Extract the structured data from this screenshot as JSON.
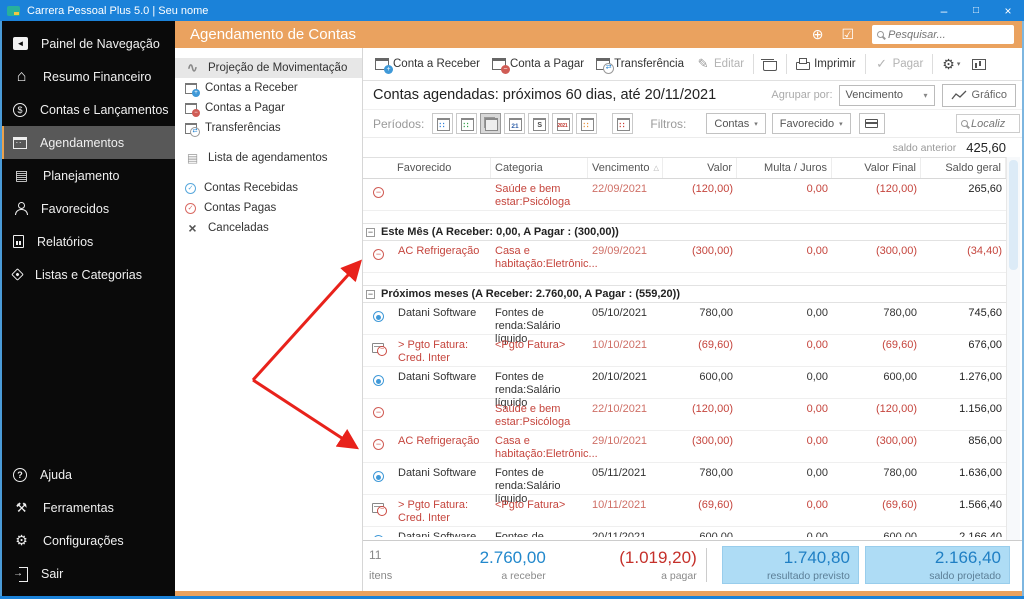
{
  "window": {
    "title": "Carrera Pessoal Plus 5.0 | Seu nome",
    "controls": [
      {
        "name": "minimize",
        "glyph": "–"
      },
      {
        "name": "maximize",
        "glyph": "□"
      },
      {
        "name": "close",
        "glyph": "×"
      }
    ]
  },
  "header": {
    "title": "Agendamento de Contas",
    "add_icon": "⊕",
    "check_icon": "☑",
    "search_placeholder": "Pesquisar..."
  },
  "nav_sidebar": {
    "items": [
      {
        "name": "panel",
        "label": "Painel de Navegação",
        "icon": "panel",
        "glyph": "◄"
      },
      {
        "name": "resumo",
        "label": "Resumo Financeiro",
        "icon": "home",
        "glyph": "⌂"
      },
      {
        "name": "contas",
        "label": "Contas e Lançamentos",
        "icon": "coins",
        "glyph": "$"
      },
      {
        "name": "agendamentos",
        "label": "Agendamentos",
        "icon": "calendar",
        "selected": true
      },
      {
        "name": "planejamento",
        "label": "Planejamento",
        "icon": "rows",
        "glyph": "▤"
      },
      {
        "name": "favorecidos",
        "label": "Favorecidos",
        "icon": "people"
      },
      {
        "name": "relatorios",
        "label": "Relatórios",
        "icon": "doc"
      },
      {
        "name": "listas",
        "label": "Listas e Categorias",
        "icon": "tag"
      }
    ],
    "footer_items": [
      {
        "name": "ajuda",
        "label": "Ajuda",
        "icon": "help",
        "glyph": "?"
      },
      {
        "name": "ferramentas",
        "label": "Ferramentas",
        "icon": "tools",
        "glyph": "⚒"
      },
      {
        "name": "configuracoes",
        "label": "Configurações",
        "icon": "gear",
        "glyph": "⚙"
      },
      {
        "name": "sair",
        "label": "Sair",
        "icon": "exit",
        "glyph": "→"
      }
    ]
  },
  "sub_sidebar": {
    "items": [
      {
        "label": "Projeção de Movimentação",
        "icon": "chart",
        "glyph": "∿",
        "selected": true
      },
      {
        "label": "Contas a Receber",
        "icon": "cal-plus"
      },
      {
        "label": "Contas a Pagar",
        "icon": "cal-minus"
      },
      {
        "label": "Transferências",
        "icon": "cal-arrows"
      },
      {
        "label": "Lista de agendamentos",
        "icon": "list",
        "glyph": "▤",
        "gap": true
      },
      {
        "label": "Contas Recebidas",
        "icon": "check-blue",
        "glyph": "✓",
        "gap": true
      },
      {
        "label": "Contas Pagas",
        "icon": "check-red",
        "glyph": "✓"
      },
      {
        "label": "Canceladas",
        "icon": "x",
        "glyph": "×"
      }
    ]
  },
  "toolbar": {
    "items": [
      {
        "name": "conta-a-receber",
        "label": "Conta a Receber",
        "icon": "cal-plus"
      },
      {
        "name": "conta-a-pagar",
        "label": "Conta a Pagar",
        "icon": "cal-minus"
      },
      {
        "name": "transferencia",
        "label": "Transferência",
        "icon": "cal-arrows"
      },
      {
        "name": "editar",
        "label": "Editar",
        "icon": "pencil",
        "glyph": "✎",
        "disabled": true
      },
      {
        "divider": true
      },
      {
        "name": "excluir",
        "label": "",
        "icon": "trash"
      },
      {
        "divider": true
      },
      {
        "name": "imprimir",
        "label": "Imprimir",
        "icon": "printer"
      },
      {
        "divider": true
      },
      {
        "name": "pagar",
        "label": "Pagar",
        "icon": "check",
        "glyph": "✓",
        "disabled": true
      },
      {
        "divider": true
      },
      {
        "name": "opcoes",
        "label": "",
        "icon": "gear",
        "glyph": "⚙"
      },
      {
        "name": "colunas",
        "label": "",
        "icon": "columns"
      }
    ]
  },
  "content_header": {
    "title": "Contas agendadas: próximos 60 dias, até 20/11/2021",
    "group_by_label": "Agrupar por:",
    "group_by_value": "Vencimento",
    "chart_button_label": "Gráfico"
  },
  "filter_bar": {
    "periods_label": "Períodos:",
    "period_buttons": [
      {
        "name": "week-blue"
      },
      {
        "name": "week-green"
      },
      {
        "name": "stack",
        "selected": true
      },
      {
        "name": "day-21"
      },
      {
        "name": "week-s"
      },
      {
        "name": "year-2021"
      },
      {
        "name": "month-orange"
      },
      {
        "name": "custom-red",
        "gap": true
      }
    ],
    "filters_label": "Filtros:",
    "filter_buttons": [
      {
        "label": "Contas"
      },
      {
        "label": "Favorecido"
      }
    ],
    "search_placeholder": "Localiz"
  },
  "table": {
    "prev_balance_label": "saldo anterior",
    "prev_balance_value": "425,60",
    "columns": [
      "Favorecido",
      "Categoria",
      "Vencimento",
      "Valor",
      "Multa / Juros",
      "Valor Final",
      "Saldo geral"
    ],
    "rows": [
      {
        "type": "row",
        "icon": "minus",
        "neg": true,
        "favorecido": "",
        "categoria": "Saúde e bem estar:Psicóloga",
        "vencimento": "22/09/2021",
        "valor": "(120,00)",
        "multa": "0,00",
        "valor_final": "(120,00)",
        "saldo": "265,60"
      },
      {
        "type": "spacer"
      },
      {
        "type": "group",
        "label": "Este Mês (A Receber: 0,00,  A Pagar : (300,00))"
      },
      {
        "type": "row",
        "icon": "minus",
        "neg": true,
        "saldo_neg": true,
        "favorecido": "AC Refrigeração",
        "categoria": "Casa e habitação:Eletrônic...",
        "vencimento": "29/09/2021",
        "valor": "(300,00)",
        "multa": "0,00",
        "valor_final": "(300,00)",
        "saldo": "(34,40)"
      },
      {
        "type": "spacer"
      },
      {
        "type": "group",
        "label": "Próximos meses (A Receber: 2.760,00,  A Pagar : (559,20))"
      },
      {
        "type": "row",
        "icon": "plus",
        "favorecido": "Datani Software",
        "categoria": "Fontes de renda:Salário líquido",
        "vencimento": "05/10/2021",
        "valor": "780,00",
        "multa": "0,00",
        "valor_final": "780,00",
        "saldo": "745,60"
      },
      {
        "type": "row",
        "icon": "card",
        "neg": true,
        "favorecido": "> Pgto Fatura: Cred. Inter",
        "categoria": "<Pgto Fatura>",
        "vencimento": "10/10/2021",
        "valor": "(69,60)",
        "multa": "0,00",
        "valor_final": "(69,60)",
        "saldo": "676,00"
      },
      {
        "type": "row",
        "icon": "plus",
        "favorecido": "Datani Software",
        "categoria": "Fontes de renda:Salário líquido",
        "vencimento": "20/10/2021",
        "valor": "600,00",
        "multa": "0,00",
        "valor_final": "600,00",
        "saldo": "1.276,00"
      },
      {
        "type": "row",
        "icon": "minus",
        "neg": true,
        "favorecido": "",
        "categoria": "Saúde e bem estar:Psicóloga",
        "vencimento": "22/10/2021",
        "valor": "(120,00)",
        "multa": "0,00",
        "valor_final": "(120,00)",
        "saldo": "1.156,00"
      },
      {
        "type": "row",
        "icon": "minus",
        "neg": true,
        "favorecido": "AC Refrigeração",
        "categoria": "Casa e habitação:Eletrônic...",
        "vencimento": "29/10/2021",
        "valor": "(300,00)",
        "multa": "0,00",
        "valor_final": "(300,00)",
        "saldo": "856,00"
      },
      {
        "type": "row",
        "icon": "plus",
        "favorecido": "Datani Software",
        "categoria": "Fontes de renda:Salário líquido",
        "vencimento": "05/11/2021",
        "valor": "780,00",
        "multa": "0,00",
        "valor_final": "780,00",
        "saldo": "1.636,00"
      },
      {
        "type": "row",
        "icon": "card",
        "neg": true,
        "favorecido": "> Pgto Fatura: Cred. Inter",
        "categoria": "<Pgto Fatura>",
        "vencimento": "10/11/2021",
        "valor": "(69,60)",
        "multa": "0,00",
        "valor_final": "(69,60)",
        "saldo": "1.566,40"
      },
      {
        "type": "row",
        "icon": "plus",
        "clipped": true,
        "favorecido": "Datani Software",
        "categoria": "Fontes de renda:Salário líquido",
        "vencimento": "20/11/2021",
        "valor": "600,00",
        "multa": "0,00",
        "valor_final": "600,00",
        "saldo": "2.166,40"
      }
    ]
  },
  "summary": {
    "count": "11",
    "count_label": "itens",
    "receber_value": "2.760,00",
    "receber_label": "a receber",
    "pagar_value": "(1.019,20)",
    "pagar_label": "a pagar",
    "previsto_value": "1.740,80",
    "previsto_label": "resultado previsto",
    "projetado_value": "2.166,40",
    "projetado_label": "saldo projetado"
  },
  "annotation": {
    "arrow_color": "#e8221b"
  }
}
